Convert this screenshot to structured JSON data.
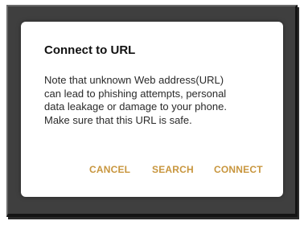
{
  "dialog": {
    "title": "Connect to URL",
    "message_lines": [
      "Note that unknown Web address(URL)",
      "can lead to phishing attempts, personal",
      "data leakage or damage to your phone.",
      "Make sure that this URL is safe."
    ],
    "buttons": {
      "cancel": "CANCEL",
      "search": "SEARCH",
      "connect": "CONNECT"
    }
  },
  "colors": {
    "button_text": "#c8963e",
    "frame": "#3f3f3f",
    "dialog_background": "#ffffff"
  }
}
